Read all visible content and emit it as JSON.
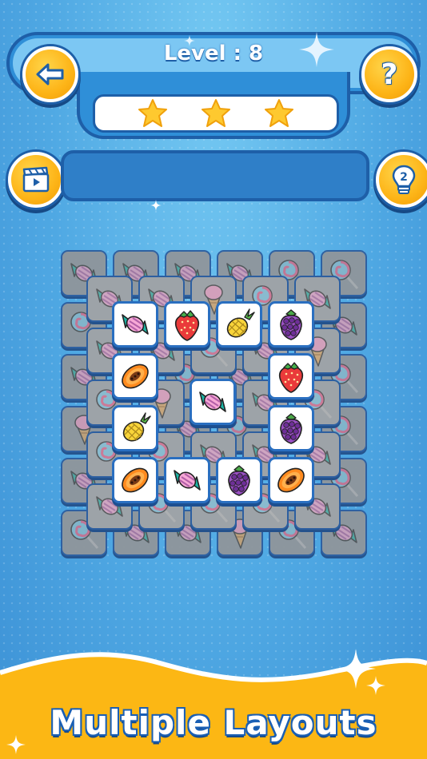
{
  "header": {
    "level_label": "Level : 8",
    "back_button_icon": "arrow-left-icon",
    "help_button_icon": "question-mark-icon",
    "help_glyph": "?",
    "stars_earned": 3,
    "stars_total": 3
  },
  "tools": {
    "video_button_icon": "clapperboard-play-icon",
    "hint_button_icon": "lightbulb-icon",
    "hint_count": "2"
  },
  "board": {
    "bottom_layer_items": [
      "candy",
      "candy",
      "candy",
      "candy",
      "lollipop",
      "lollipop",
      "lollipop",
      "candy",
      "candy",
      "ice-cream",
      "lollipop",
      "candy",
      "candy",
      "candy",
      "lollipop",
      "candy",
      "ice-cream",
      "lollipop",
      "ice-cream",
      "lollipop",
      "candy",
      "lollipop",
      "lollipop",
      "lollipop"
    ],
    "open_tiles": [
      "candy",
      "strawberry",
      "pineapple",
      "blackberry",
      "papaya",
      "strawberry",
      "candy",
      "pineapple",
      "blackberry",
      "papaya",
      "candy",
      "blackberry",
      "papaya"
    ]
  },
  "footer": {
    "caption": "Multiple Layouts"
  },
  "colors": {
    "background": "#4fa8e3",
    "panel_border": "#1e5fa8",
    "button_gold": "#fdb417",
    "footer_wave": "#fbb315",
    "tile_face": "#ffffff"
  }
}
